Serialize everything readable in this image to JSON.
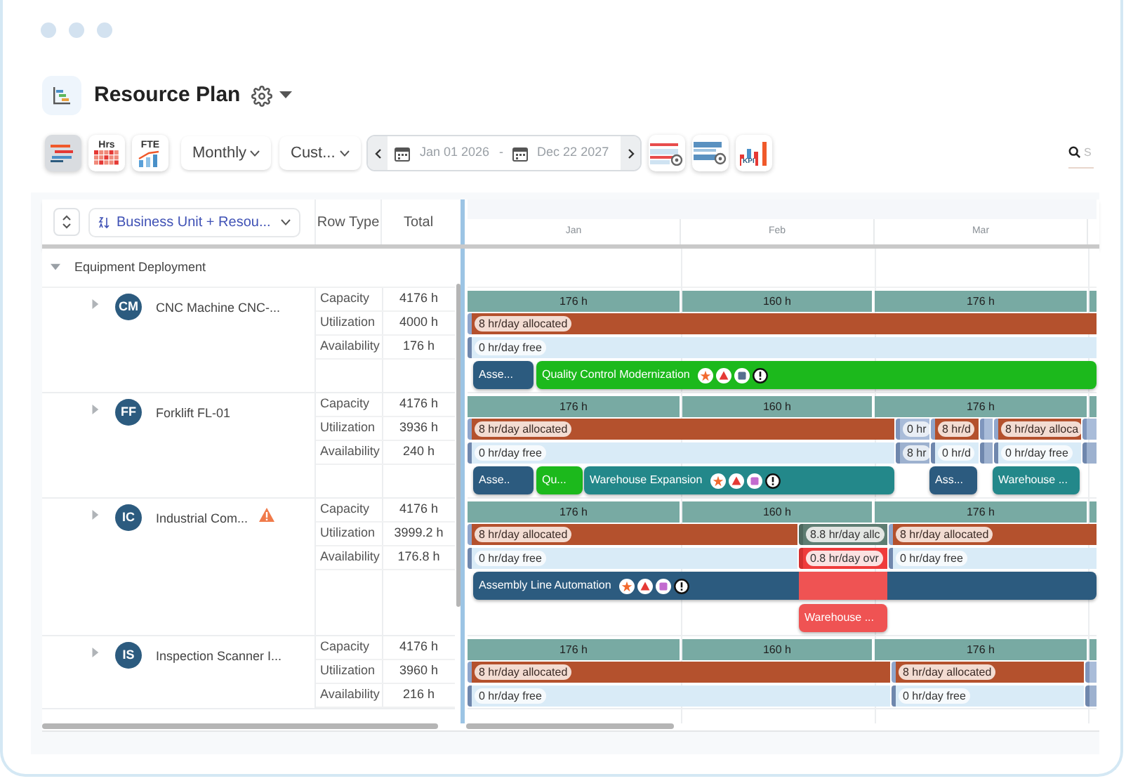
{
  "header": {
    "title": "Resource Plan"
  },
  "toolbar": {
    "views": [
      {
        "kind": "gantt",
        "selected": true
      },
      {
        "kind": "heatmap",
        "label": "Hrs",
        "selected": false
      },
      {
        "kind": "fte",
        "label": "FTE",
        "selected": false
      }
    ],
    "scale": {
      "value": "Monthly"
    },
    "preset": {
      "value": "Cust..."
    },
    "range": {
      "start": "Jan 01 2026",
      "separator": "-",
      "end": "Dec 22 2027"
    },
    "tools": [
      {
        "kind": "rows"
      },
      {
        "kind": "bars"
      },
      {
        "kind": "kpi",
        "label": "KPI"
      }
    ],
    "search": {
      "placeholder": "S"
    }
  },
  "grid": {
    "grouping": "Business Unit + Resou...",
    "columns": [
      "Row Type",
      "Total"
    ],
    "months": [
      "Jan",
      "Feb",
      "Mar"
    ],
    "group": {
      "label": "Equipment Deployment",
      "expanded": true
    },
    "resources": [
      {
        "initials": "CM",
        "name": "CNC Machine CNC-...",
        "warning": false,
        "expanded": false,
        "rows": [
          {
            "type": "Capacity",
            "total": "4176 h"
          },
          {
            "type": "Utilization",
            "total": "4000 h"
          },
          {
            "type": "Availability",
            "total": "176 h"
          }
        ],
        "capacity": [
          "176 h",
          "160 h",
          "176 h"
        ],
        "utilization": [
          {
            "kind": "allocated",
            "label": "8 hr/day allocated"
          }
        ],
        "availability": [
          {
            "kind": "free",
            "label": "0 hr/day free"
          }
        ],
        "lanes": [
          [
            {
              "label": "Asse...",
              "color": "#2c5b7f"
            },
            {
              "label": "Quality Control Modernization",
              "color": "#1cb91c",
              "badges": [
                {
                  "kind": "star"
                },
                {
                  "kind": "triangle"
                },
                {
                  "kind": "square",
                  "color": "#56708f"
                },
                {
                  "kind": "alert"
                }
              ]
            }
          ]
        ]
      },
      {
        "initials": "FF",
        "name": "Forklift FL-01",
        "warning": false,
        "expanded": false,
        "rows": [
          {
            "type": "Capacity",
            "total": "4176 h"
          },
          {
            "type": "Utilization",
            "total": "3936 h"
          },
          {
            "type": "Availability",
            "total": "240 h"
          }
        ],
        "capacity": [
          "176 h",
          "160 h",
          "176 h"
        ],
        "utilization": [
          {
            "kind": "allocated",
            "label": "8 hr/day allocated"
          },
          {
            "kind": "idle",
            "label": "0 hr"
          },
          {
            "kind": "allocated",
            "label": "8 hr/d"
          },
          {
            "kind": "idle"
          },
          {
            "kind": "allocated",
            "label": "8 hr/day alloca"
          },
          {
            "kind": "idle"
          }
        ],
        "availability": [
          {
            "kind": "free",
            "label": "0 hr/day free"
          },
          {
            "kind": "booked",
            "label": "8 hr"
          },
          {
            "kind": "free",
            "label": "0 hr/d"
          },
          {
            "kind": "booked"
          },
          {
            "kind": "free",
            "label": "0 hr/day free"
          },
          {
            "kind": "booked"
          }
        ],
        "lanes": [
          [
            {
              "label": "Asse..",
              "color": "#2c5b7f"
            },
            {
              "label": "Qu...",
              "color": "#1cb91c"
            },
            {
              "label": "Warehouse Expansion",
              "color": "#23888a",
              "badges": [
                {
                  "kind": "star"
                },
                {
                  "kind": "triangle"
                },
                {
                  "kind": "square",
                  "color": "#c26bcf"
                },
                {
                  "kind": "alert"
                }
              ]
            },
            {
              "label": "Ass...",
              "color": "#2c5b7f"
            },
            {
              "label": "Warehouse ...",
              "color": "#23888a"
            }
          ]
        ]
      },
      {
        "initials": "IC",
        "name": "Industrial Com...",
        "warning": true,
        "expanded": false,
        "rows": [
          {
            "type": "Capacity",
            "total": "4176 h"
          },
          {
            "type": "Utilization",
            "total": "3999.2 h"
          },
          {
            "type": "Availability",
            "total": "176.8 h"
          }
        ],
        "capacity": [
          "176 h",
          "160 h",
          "176 h"
        ],
        "utilization": [
          {
            "kind": "allocated",
            "label": "8 hr/day allocated"
          },
          {
            "kind": "mixed",
            "label": "8.8 hr/day allc"
          },
          {
            "kind": "allocated",
            "label": "8 hr/day allocated"
          }
        ],
        "availability": [
          {
            "kind": "free",
            "label": "0 hr/day free"
          },
          {
            "kind": "over",
            "label": "0.8 hr/day ovr"
          },
          {
            "kind": "free",
            "label": "0 hr/day free"
          }
        ],
        "lanes": [
          [
            {
              "label": "Assembly Line Automation",
              "color": "#2c5b7f",
              "conflict": true,
              "badges": [
                {
                  "kind": "star"
                },
                {
                  "kind": "triangle"
                },
                {
                  "kind": "square",
                  "color": "#c26bcf"
                },
                {
                  "kind": "alert"
                }
              ]
            }
          ],
          [
            {
              "label": "Warehouse ...",
              "color": "#ef5353"
            }
          ]
        ]
      },
      {
        "initials": "IS",
        "name": "Inspection Scanner I...",
        "warning": false,
        "expanded": false,
        "rows": [
          {
            "type": "Capacity",
            "total": "4176 h"
          },
          {
            "type": "Utilization",
            "total": "3960 h"
          },
          {
            "type": "Availability",
            "total": "216 h"
          }
        ],
        "capacity": [
          "176 h",
          "160 h",
          "176 h"
        ],
        "utilization": [
          {
            "kind": "allocated",
            "label": "8 hr/day allocated"
          },
          {
            "kind": "allocated",
            "label": "8 hr/day allocated"
          },
          {
            "kind": "idle"
          }
        ],
        "availability": [
          {
            "kind": "free",
            "label": "0 hr/day free"
          },
          {
            "kind": "free",
            "label": "0 hr/day free"
          },
          {
            "kind": "booked"
          }
        ]
      }
    ]
  }
}
